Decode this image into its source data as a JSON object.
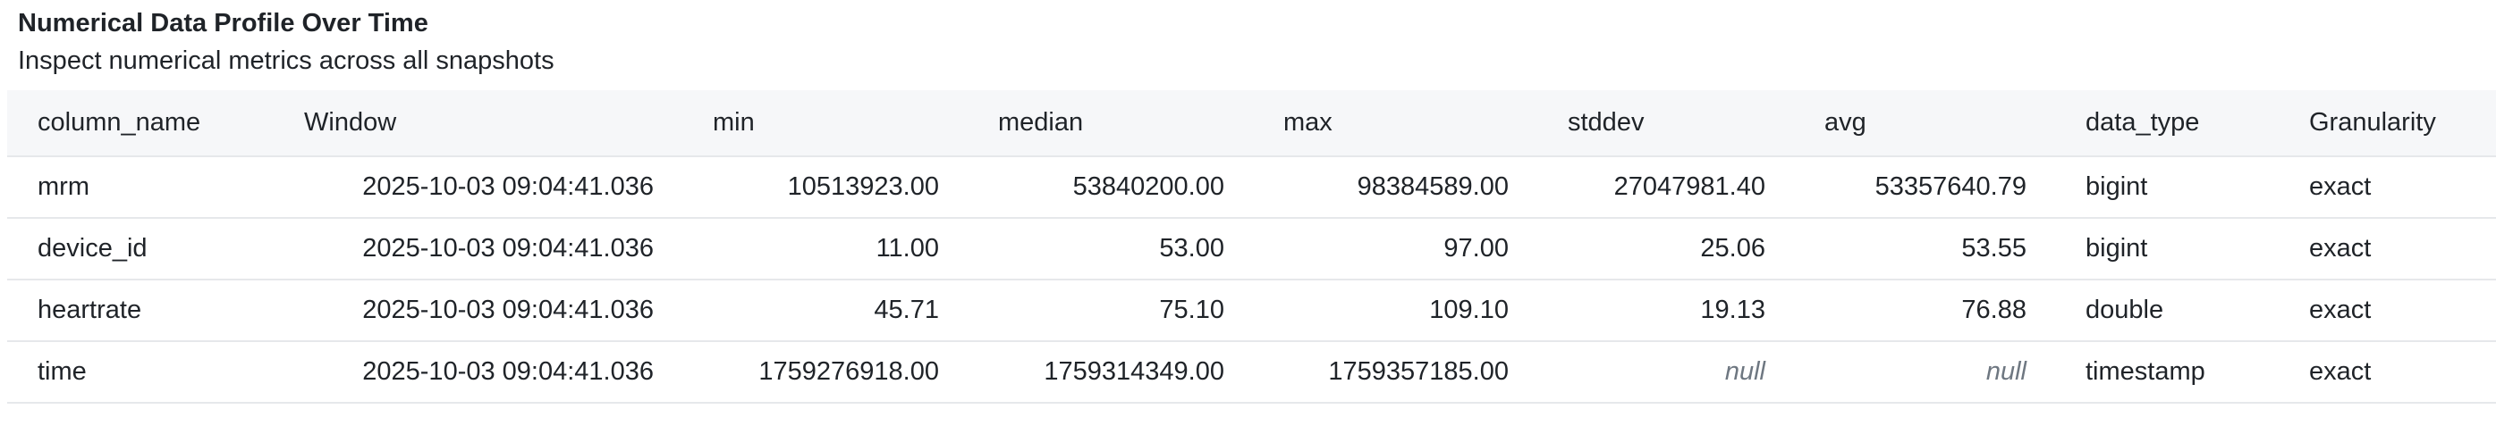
{
  "header": {
    "title": "Numerical Data Profile Over Time",
    "subtitle": "Inspect numerical metrics across all snapshots"
  },
  "table": {
    "columns": [
      "column_name",
      "Window",
      "min",
      "median",
      "max",
      "stddev",
      "avg",
      "data_type",
      "Granularity"
    ],
    "rows": [
      [
        "mrm",
        "2025-10-03 09:04:41.036",
        "10513923.00",
        "53840200.00",
        "98384589.00",
        "27047981.40",
        "53357640.79",
        "bigint",
        "exact"
      ],
      [
        "device_id",
        "2025-10-03 09:04:41.036",
        "11.00",
        "53.00",
        "97.00",
        "25.06",
        "53.55",
        "bigint",
        "exact"
      ],
      [
        "heartrate",
        "2025-10-03 09:04:41.036",
        "45.71",
        "75.10",
        "109.10",
        "19.13",
        "76.88",
        "double",
        "exact"
      ],
      [
        "time",
        "2025-10-03 09:04:41.036",
        "1759276918.00",
        "1759314349.00",
        "1759357185.00",
        "null",
        "null",
        "timestamp",
        "exact"
      ]
    ]
  },
  "colors": {
    "header_bg": "#f6f7f9",
    "border": "#e6e8eb",
    "null_text": "#6e7781"
  }
}
